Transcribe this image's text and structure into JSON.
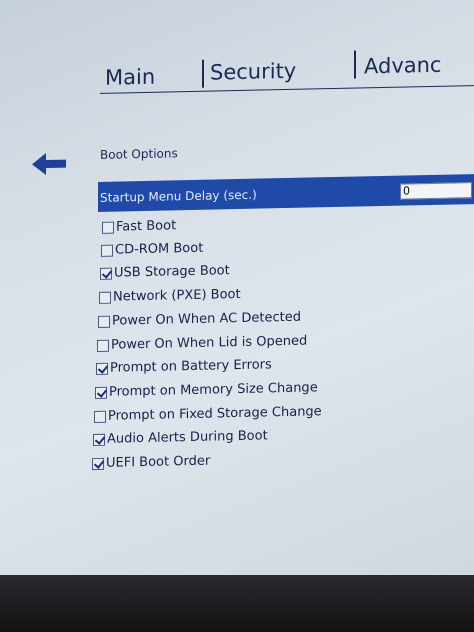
{
  "tabs": [
    {
      "label": "Main"
    },
    {
      "label": "Security"
    },
    {
      "label": "Advanc"
    }
  ],
  "section_title": "Boot Options",
  "startup_delay": {
    "label": "Startup Menu Delay (sec.)",
    "value": "0"
  },
  "options": [
    {
      "label": "Fast Boot",
      "checked": false
    },
    {
      "label": "CD-ROM Boot",
      "checked": false
    },
    {
      "label": "USB Storage Boot",
      "checked": true
    },
    {
      "label": "Network (PXE) Boot",
      "checked": false
    },
    {
      "label": "Power On When AC Detected",
      "checked": false
    },
    {
      "label": "Power On When Lid is Opened",
      "checked": false
    },
    {
      "label": "Prompt on Battery Errors",
      "checked": true
    },
    {
      "label": "Prompt on Memory Size Change",
      "checked": true
    },
    {
      "label": "Prompt on Fixed Storage Change",
      "checked": false
    },
    {
      "label": "Audio Alerts During Boot",
      "checked": true
    },
    {
      "label": "UEFI Boot Order",
      "checked": true
    }
  ],
  "colors": {
    "accent": "#1f4aa8",
    "text": "#15224a"
  },
  "icons": {
    "back": "arrow-left-icon"
  }
}
